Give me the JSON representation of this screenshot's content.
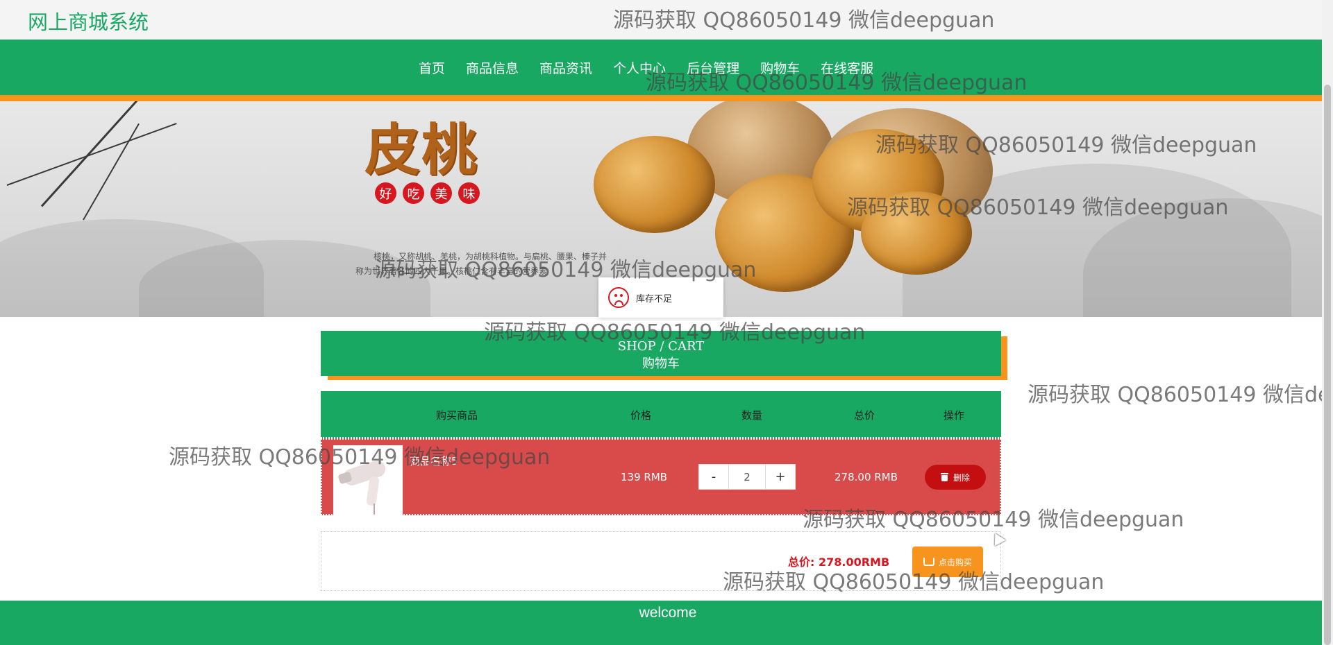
{
  "header": {
    "site_title": "网上商城系统"
  },
  "nav": {
    "items": [
      "首页",
      "商品信息",
      "商品资讯",
      "个人中心",
      "后台管理",
      "购物车",
      "在线客服"
    ]
  },
  "banner": {
    "title": "皮桃",
    "tags": [
      "好",
      "吃",
      "美",
      "味"
    ],
    "text_line1": "核桃，又称胡桃、羌桃，为胡桃科植物。与扁桃、腰果、榛子并",
    "text_line2": "称为世界著名的四大干果。核桃仁含有丰富的营养素"
  },
  "toast": {
    "message": "库存不足"
  },
  "cart_header": {
    "en": "SHOP / CART",
    "cn": "购物车"
  },
  "table": {
    "headers": [
      "购买商品",
      "价格",
      "数量",
      "总价",
      "操作"
    ],
    "rows": [
      {
        "name": "商品名称5",
        "price": "139 RMB",
        "quantity": "2",
        "total": "278.00 RMB",
        "minus": "-",
        "plus": "+",
        "delete_label": "删除"
      }
    ]
  },
  "summary": {
    "total_label": "总价:",
    "total_value": "278.00RMB",
    "buy_label": "点击购买"
  },
  "footer": {
    "text": "welcome"
  },
  "watermark": "源码获取 QQ86050149 微信deepguan",
  "colors": {
    "primary_green": "#18a862",
    "accent_orange": "#f7941d",
    "row_red": "#d94a4a",
    "delete_red": "#c40f12"
  }
}
